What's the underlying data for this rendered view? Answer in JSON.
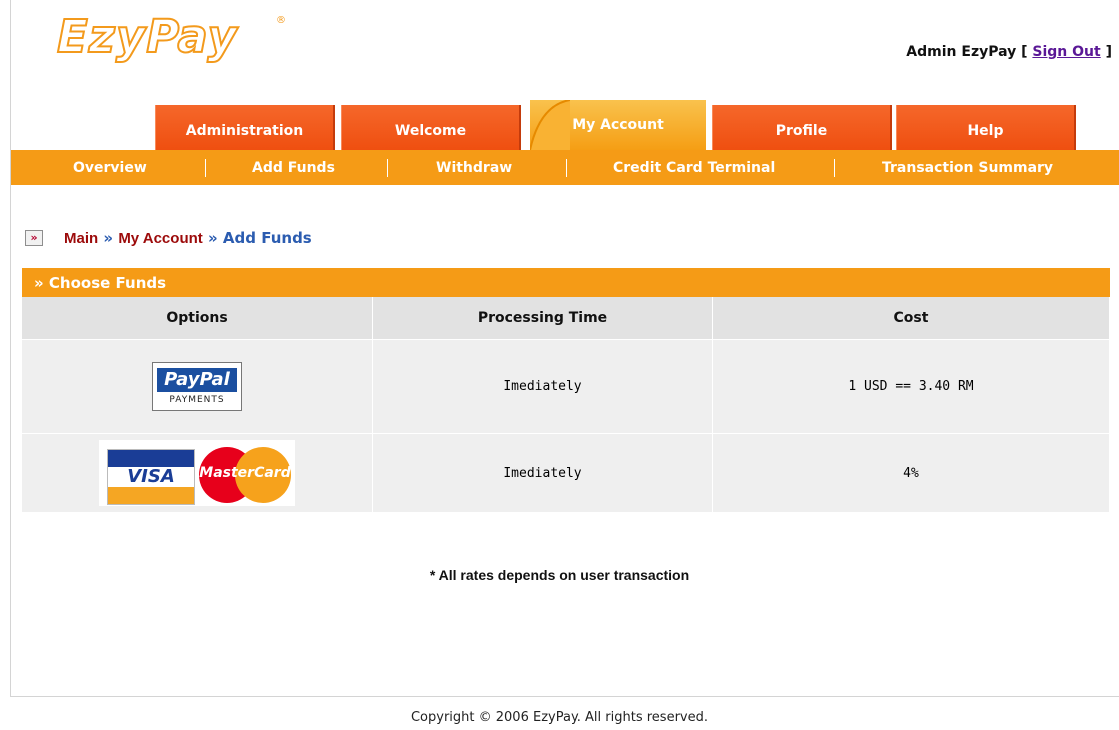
{
  "brand": {
    "logo_text": "EzyPay",
    "registered": "®"
  },
  "user": {
    "name_text": "Admin EzyPay [ ",
    "signout_label": "Sign Out",
    "bracket_close": " ]"
  },
  "tabs": [
    {
      "label": "Administration"
    },
    {
      "label": "Welcome"
    },
    {
      "label": "My Account",
      "active": true
    },
    {
      "label": "Profile"
    },
    {
      "label": "Help"
    }
  ],
  "subnav": [
    {
      "label": "Overview"
    },
    {
      "label": "Add Funds"
    },
    {
      "label": "Withdraw"
    },
    {
      "label": "Credit Card Terminal"
    },
    {
      "label": "Transaction Summary"
    }
  ],
  "breadcrumb": {
    "icon": "»",
    "main": "Main",
    "sep1": " » ",
    "account": "My Account",
    "sep2": " » ",
    "current": "Add Funds"
  },
  "panel": {
    "title": "» Choose Funds",
    "columns": [
      "Options",
      "Processing Time",
      "Cost"
    ],
    "rows": [
      {
        "option": "PayPal",
        "option_sub": "PAYMENTS",
        "time": "Imediately",
        "cost": "1 USD == 3.40 RM"
      },
      {
        "option": "VISA",
        "option_b": "MasterCard",
        "time": "Imediately",
        "cost": "4%"
      }
    ]
  },
  "note": "* All rates depends on user transaction",
  "footer": "Copyright © 2006 EzyPay. All rights reserved.",
  "colors": {
    "orange": "#f59b16",
    "tab_red": "#ef4f10",
    "crumb_red": "#9c0a0a",
    "crumb_blue": "#2b5cb0"
  }
}
